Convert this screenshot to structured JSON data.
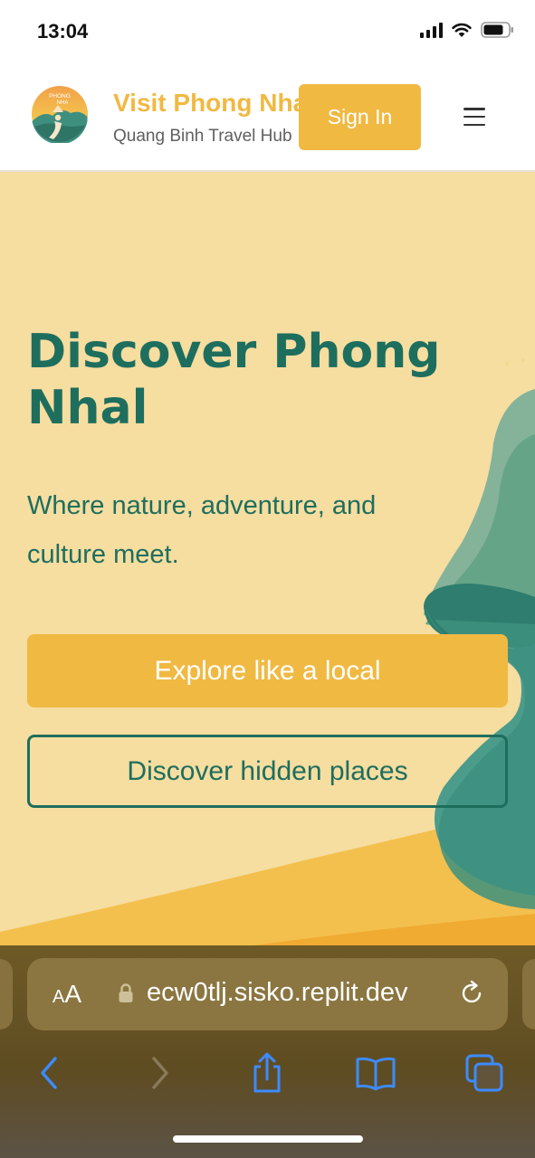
{
  "status_bar": {
    "time": "13:04"
  },
  "header": {
    "logo_text": [
      "PHONG",
      "NHA"
    ],
    "title": "Visit Phong Nha",
    "subtitle": "Quang Binh Travel Hub",
    "signin_label": "Sign In"
  },
  "hero": {
    "title": "Discover Phong Nhal",
    "subtitle": "Where nature, adventure, and culture meet.",
    "primary_cta": "Explore like a local",
    "secondary_cta": "Discover hidden places"
  },
  "browser": {
    "aa_label_big": "A",
    "aa_label_small": "A",
    "url": "ecw0tlj.sisko.replit.dev"
  },
  "colors": {
    "accent": "#f0b942",
    "primary_green": "#1e6e5e",
    "hero_bg": "#f6dda0",
    "safari_blue": "#3d8bff"
  }
}
